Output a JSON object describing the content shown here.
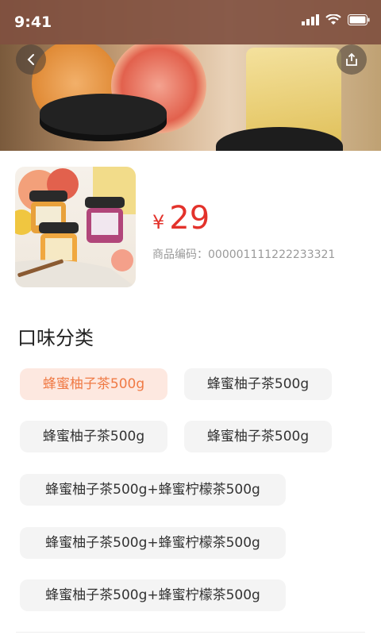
{
  "status_bar": {
    "time": "9:41"
  },
  "product": {
    "price_symbol": "¥",
    "price": "29",
    "sku_text": "商品编码：000001111222233321"
  },
  "flavor": {
    "title": "口味分类",
    "options": [
      {
        "label": "蜂蜜柚子茶500g",
        "selected": true
      },
      {
        "label": "蜂蜜柚子茶500g",
        "selected": false
      },
      {
        "label": "蜂蜜柚子茶500g",
        "selected": false
      },
      {
        "label": "蜂蜜柚子茶500g",
        "selected": false
      },
      {
        "label": "蜂蜜柚子茶500g+蜂蜜柠檬茶500g",
        "selected": false
      },
      {
        "label": "蜂蜜柚子茶500g+蜂蜜柠檬茶500g",
        "selected": false
      },
      {
        "label": "蜂蜜柚子茶500g+蜂蜜柠檬茶500g",
        "selected": false
      }
    ]
  },
  "colors": {
    "price": "#e3322b",
    "chip_active_bg": "#fde8e0",
    "chip_active_text": "#f07a45"
  },
  "icons": [
    "back-icon",
    "share-icon",
    "signal-icon",
    "wifi-icon",
    "battery-icon"
  ]
}
